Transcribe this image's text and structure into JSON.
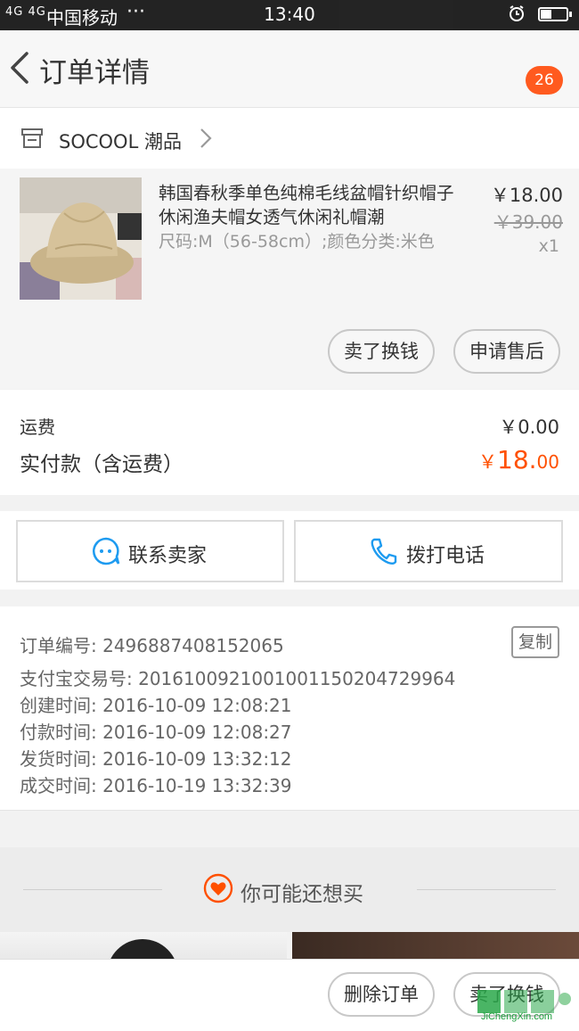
{
  "status_bar": {
    "signal": "4G 4G",
    "carrier": "中国移动",
    "dots": "···",
    "time": "13:40"
  },
  "header": {
    "title": "订单详情",
    "badge_count": "26"
  },
  "shop": {
    "name": "SOCOOL 潮品"
  },
  "product": {
    "title": "韩国春秋季单色纯棉毛线盆帽针织帽子休闲渔夫帽女透气休闲礼帽潮",
    "spec": "尺码:M（56-58cm）;颜色分类:米色",
    "price": "￥18.00",
    "original_price": "￥39.00",
    "quantity": "x1",
    "actions": {
      "resell": "卖了换钱",
      "after_sale": "申请售后"
    }
  },
  "fees": {
    "shipping_label": "运费",
    "shipping_value": "￥0.00",
    "paid_label": "实付款（含运费）",
    "paid_symbol": "￥",
    "paid_integer": "18.",
    "paid_decimal": "00"
  },
  "contact": {
    "seller": "联系卖家",
    "call": "拨打电话"
  },
  "order_info": {
    "copy": "复制",
    "lines": [
      "订单编号: 2496887408152065",
      "支付宝交易号: 2016100921001001150204729964",
      "创建时间: 2016-10-09 12:08:21",
      "付款时间: 2016-10-09 12:08:27",
      "发货时间: 2016-10-09 13:32:12",
      "成交时间: 2016-10-19 13:32:39"
    ]
  },
  "recommend": {
    "title": "你可能还想买"
  },
  "bottom_bar": {
    "delete_order": "删除订单",
    "resell": "卖了换钱"
  },
  "watermark": {
    "text": "JiChengXin.com"
  },
  "colors": {
    "accent": "#ff5000",
    "badge": "#ff5a1f",
    "contact_icon": "#1e9bf0"
  }
}
